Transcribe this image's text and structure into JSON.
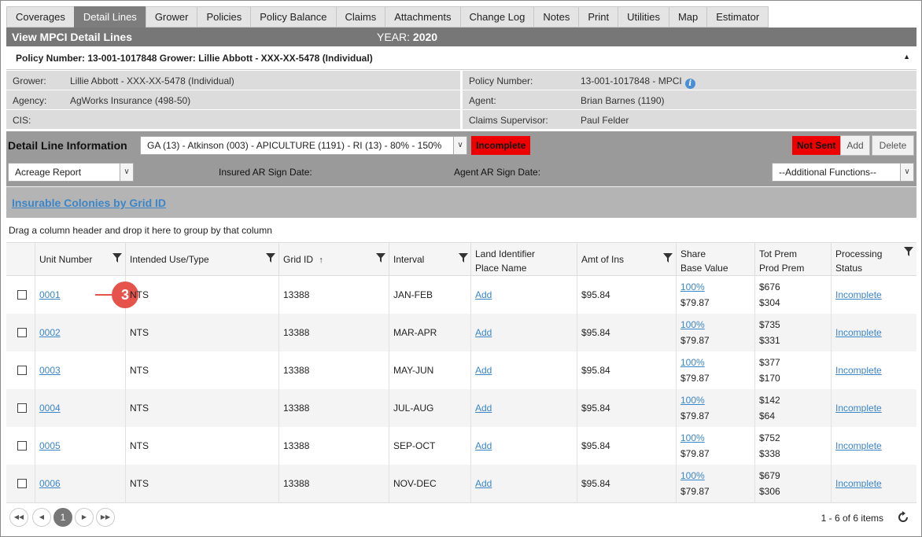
{
  "tabs": [
    "Coverages",
    "Detail Lines",
    "Grower",
    "Policies",
    "Policy Balance",
    "Claims",
    "Attachments",
    "Change Log",
    "Notes",
    "Print",
    "Utilities",
    "Map",
    "Estimator"
  ],
  "active_tab": "Detail Lines",
  "header": {
    "title": "View MPCI Detail Lines",
    "year_label": "YEAR:",
    "year": "2020"
  },
  "policy_bar": {
    "text": "Policy Number: 13-001-1017848 Grower: Lillie Abbott - XXX-XX-5478 (Individual)",
    "toggle_icon": "caret-up-icon"
  },
  "info": {
    "grower_label": "Grower:",
    "grower": "Lillie Abbott - XXX-XX-5478 (Individual)",
    "agency_label": "Agency:",
    "agency": "AgWorks Insurance (498-50)",
    "cis_label": "CIS:",
    "policy_number_label": "Policy Number:",
    "policy_number": "13-001-1017848 - MPCI",
    "agent_label": "Agent:",
    "agent": "Brian Barnes (1190)",
    "claims_supervisor_label": "Claims Supervisor:",
    "claims_supervisor": "Paul Felder"
  },
  "detail_line": {
    "title": "Detail Line Information",
    "selector_value": "GA (13) - Atkinson (003) - APICULTURE (1191) - RI (13) - 80% - 150%",
    "status": "Incomplete",
    "send_status": "Not Sent",
    "add_label": "Add",
    "delete_label": "Delete",
    "report_value": "Acreage Report",
    "insured_sign_label": "Insured AR Sign Date:",
    "agent_sign_label": "Agent AR Sign Date:",
    "additional_functions": "--Additional Functions--"
  },
  "insurable_link": "Insurable Colonies by Grid ID",
  "group_hint": "Drag a column header and drop it here to group by that column",
  "columns": {
    "unit": "Unit Number",
    "use": "Intended Use/Type",
    "grid": "Grid ID",
    "interval": "Interval",
    "land_1": "Land Identifier",
    "land_2": "Place Name",
    "amt": "Amt of Ins",
    "share_1": "Share",
    "share_2": "Base Value",
    "prem_1": "Tot Prem",
    "prem_2": "Prod Prem",
    "status_1": "Processing",
    "status_2": "Status"
  },
  "rows": [
    {
      "unit": "0001",
      "use": "NTS",
      "grid": "13388",
      "interval": "JAN-FEB",
      "land": "Add",
      "amt": "$95.84",
      "share": "100%",
      "base": "$79.87",
      "tot": "$676",
      "prod": "$304",
      "status": "Incomplete"
    },
    {
      "unit": "0002",
      "use": "NTS",
      "grid": "13388",
      "interval": "MAR-APR",
      "land": "Add",
      "amt": "$95.84",
      "share": "100%",
      "base": "$79.87",
      "tot": "$735",
      "prod": "$331",
      "status": "Incomplete"
    },
    {
      "unit": "0003",
      "use": "NTS",
      "grid": "13388",
      "interval": "MAY-JUN",
      "land": "Add",
      "amt": "$95.84",
      "share": "100%",
      "base": "$79.87",
      "tot": "$377",
      "prod": "$170",
      "status": "Incomplete"
    },
    {
      "unit": "0004",
      "use": "NTS",
      "grid": "13388",
      "interval": "JUL-AUG",
      "land": "Add",
      "amt": "$95.84",
      "share": "100%",
      "base": "$79.87",
      "tot": "$142",
      "prod": "$64",
      "status": "Incomplete"
    },
    {
      "unit": "0005",
      "use": "NTS",
      "grid": "13388",
      "interval": "SEP-OCT",
      "land": "Add",
      "amt": "$95.84",
      "share": "100%",
      "base": "$79.87",
      "tot": "$752",
      "prod": "$338",
      "status": "Incomplete"
    },
    {
      "unit": "0006",
      "use": "NTS",
      "grid": "13388",
      "interval": "NOV-DEC",
      "land": "Add",
      "amt": "$95.84",
      "share": "100%",
      "base": "$79.87",
      "tot": "$679",
      "prod": "$306",
      "status": "Incomplete"
    }
  ],
  "callout": "3",
  "pager": {
    "current_page": "1",
    "summary": "1 - 6 of 6 items"
  },
  "colors": {
    "tab_active": "#7d7d7d",
    "status_red": "#ee0000",
    "link": "#3b86c8",
    "callout": "#e5534b"
  }
}
